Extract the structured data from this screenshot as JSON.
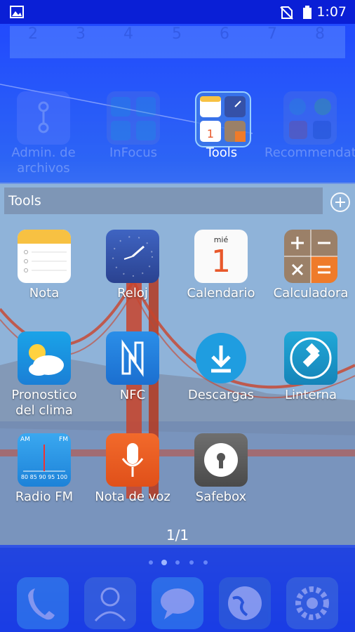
{
  "status": {
    "time": "1:07"
  },
  "page_numbers": [
    "2",
    "3",
    "4",
    "5",
    "6",
    "7",
    "8"
  ],
  "folders": [
    {
      "label": "Admin. de archivos"
    },
    {
      "label": "InFocus"
    },
    {
      "label": "Tools"
    },
    {
      "label": "Recommendations"
    }
  ],
  "tools_header": {
    "title": "Tools"
  },
  "apps": [
    {
      "label": "Nota"
    },
    {
      "label": "Reloj"
    },
    {
      "label": "Calendario",
      "day_name": "mié",
      "day_num": "1"
    },
    {
      "label": "Calculadora"
    },
    {
      "label": "Pronostico del clima"
    },
    {
      "label": "NFC"
    },
    {
      "label": "Descargas"
    },
    {
      "label": "Linterna"
    },
    {
      "label": "Radio FM",
      "am": "AM",
      "fm": "FM",
      "scale": "80 85 90 95 100"
    },
    {
      "label": "Nota de voz"
    },
    {
      "label": "Safebox"
    }
  ],
  "page_indicator": "1/1",
  "dock": [
    "phone-icon",
    "contacts-icon",
    "messages-icon",
    "browser-icon",
    "settings-icon"
  ]
}
